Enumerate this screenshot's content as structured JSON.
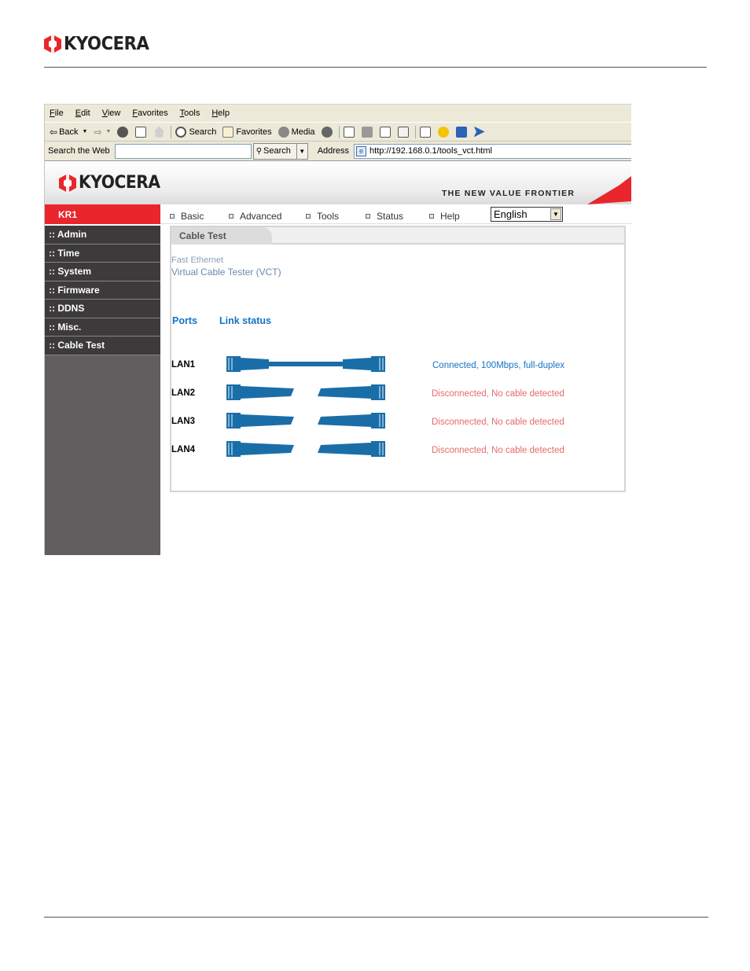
{
  "document": {
    "brand": "KYOCERA"
  },
  "browser": {
    "menu": [
      "File",
      "Edit",
      "View",
      "Favorites",
      "Tools",
      "Help"
    ],
    "toolbar": {
      "back": "Back",
      "search": "Search",
      "favorites": "Favorites",
      "media": "Media"
    },
    "search_web_label": "Search the Web",
    "search_button": "Search",
    "address_label": "Address",
    "address_url": "http://192.168.0.1/tools_vct.html"
  },
  "router": {
    "brand": "KYOCERA",
    "tagline": "THE NEW VALUE FRONTIER",
    "model": "KR1",
    "nav": [
      "Basic",
      "Advanced",
      "Tools",
      "Status",
      "Help"
    ],
    "language": "English",
    "sidebar": [
      ":: Admin",
      ":: Time",
      ":: System",
      ":: Firmware",
      ":: DDNS",
      ":: Misc.",
      ":: Cable Test"
    ],
    "panel_title": "Cable Test",
    "subtitle1": "Fast Ethernet",
    "subtitle2": "Virtual Cable Tester (VCT)",
    "col_ports": "Ports",
    "col_link": "Link status",
    "ports": [
      {
        "name": "LAN1",
        "connected": true,
        "status": "Connected, 100Mbps, full-duplex"
      },
      {
        "name": "LAN2",
        "connected": false,
        "status": "Disconnected, No cable detected"
      },
      {
        "name": "LAN3",
        "connected": false,
        "status": "Disconnected, No cable detected"
      },
      {
        "name": "LAN4",
        "connected": false,
        "status": "Disconnected, No cable detected"
      }
    ]
  },
  "colors": {
    "brand_red": "#e8262c",
    "link_blue": "#1573c4",
    "cable_blue": "#1a6ea8",
    "error_red": "#e46a6a",
    "sidebar_dark": "#3c3a3b"
  }
}
